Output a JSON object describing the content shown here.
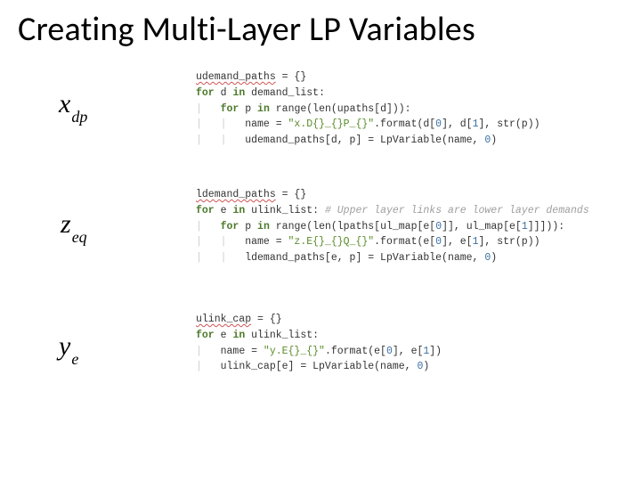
{
  "title": "Creating Multi-Layer LP Variables",
  "vars": {
    "v1": {
      "base": "x",
      "sub": "dp"
    },
    "v2": {
      "base": "z",
      "sub": "eq"
    },
    "v3": {
      "base": "y",
      "sub": "e"
    }
  },
  "code1": {
    "l1_decl": "udemand_paths",
    "l1_rest": " = {}",
    "l2_for": "for",
    "l2_mid": " d ",
    "l2_in": "in",
    "l2_rest": " demand_list:",
    "l3_for": "for",
    "l3_mid": " p ",
    "l3_in": "in",
    "l3_rest": " range(len(upaths[d])):",
    "l4a": "name = ",
    "l4s": "\"x.D{}_{}P_{}\"",
    "l4b": ".format(d[",
    "l4n0": "0",
    "l4c": "], d[",
    "l4n1": "1",
    "l4d": "], str(p))",
    "l5a": "udemand_paths[d, p] = LpVariable(name, ",
    "l5n": "0",
    "l5b": ")"
  },
  "code2": {
    "l1_decl": "ldemand_paths",
    "l1_rest": " = {}",
    "l2_for": "for",
    "l2_mid": " e ",
    "l2_in": "in",
    "l2_rest": " ulink_list: ",
    "l2_comment": "# Upper layer links are lower layer demands",
    "l3_for": "for",
    "l3_mid": " p ",
    "l3_in": "in",
    "l3_rest": " range(len(lpaths[ul_map[e[",
    "l3n0": "0",
    "l3_rest2": "]], ul_map[e[",
    "l3n1": "1",
    "l3_rest3": "]]])):",
    "l4a": "name = ",
    "l4s": "\"z.E{}_{}Q_{}\"",
    "l4b": ".format(e[",
    "l4n0": "0",
    "l4c": "], e[",
    "l4n1": "1",
    "l4d": "], str(p))",
    "l5a": "ldemand_paths[e, p] = LpVariable(name, ",
    "l5n": "0",
    "l5b": ")"
  },
  "code3": {
    "l1_decl": "ulink_cap",
    "l1_rest": " = {}",
    "l2_for": "for",
    "l2_mid": " e ",
    "l2_in": "in",
    "l2_rest": " ulink_list:",
    "l3a": "name = ",
    "l3s": "\"y.E{}_{}\"",
    "l3b": ".format(e[",
    "l3n0": "0",
    "l3c": "], e[",
    "l3n1": "1",
    "l3d": "])",
    "l4a": "ulink_cap[e] = LpVariable(name, ",
    "l4n": "0",
    "l4b": ")"
  }
}
